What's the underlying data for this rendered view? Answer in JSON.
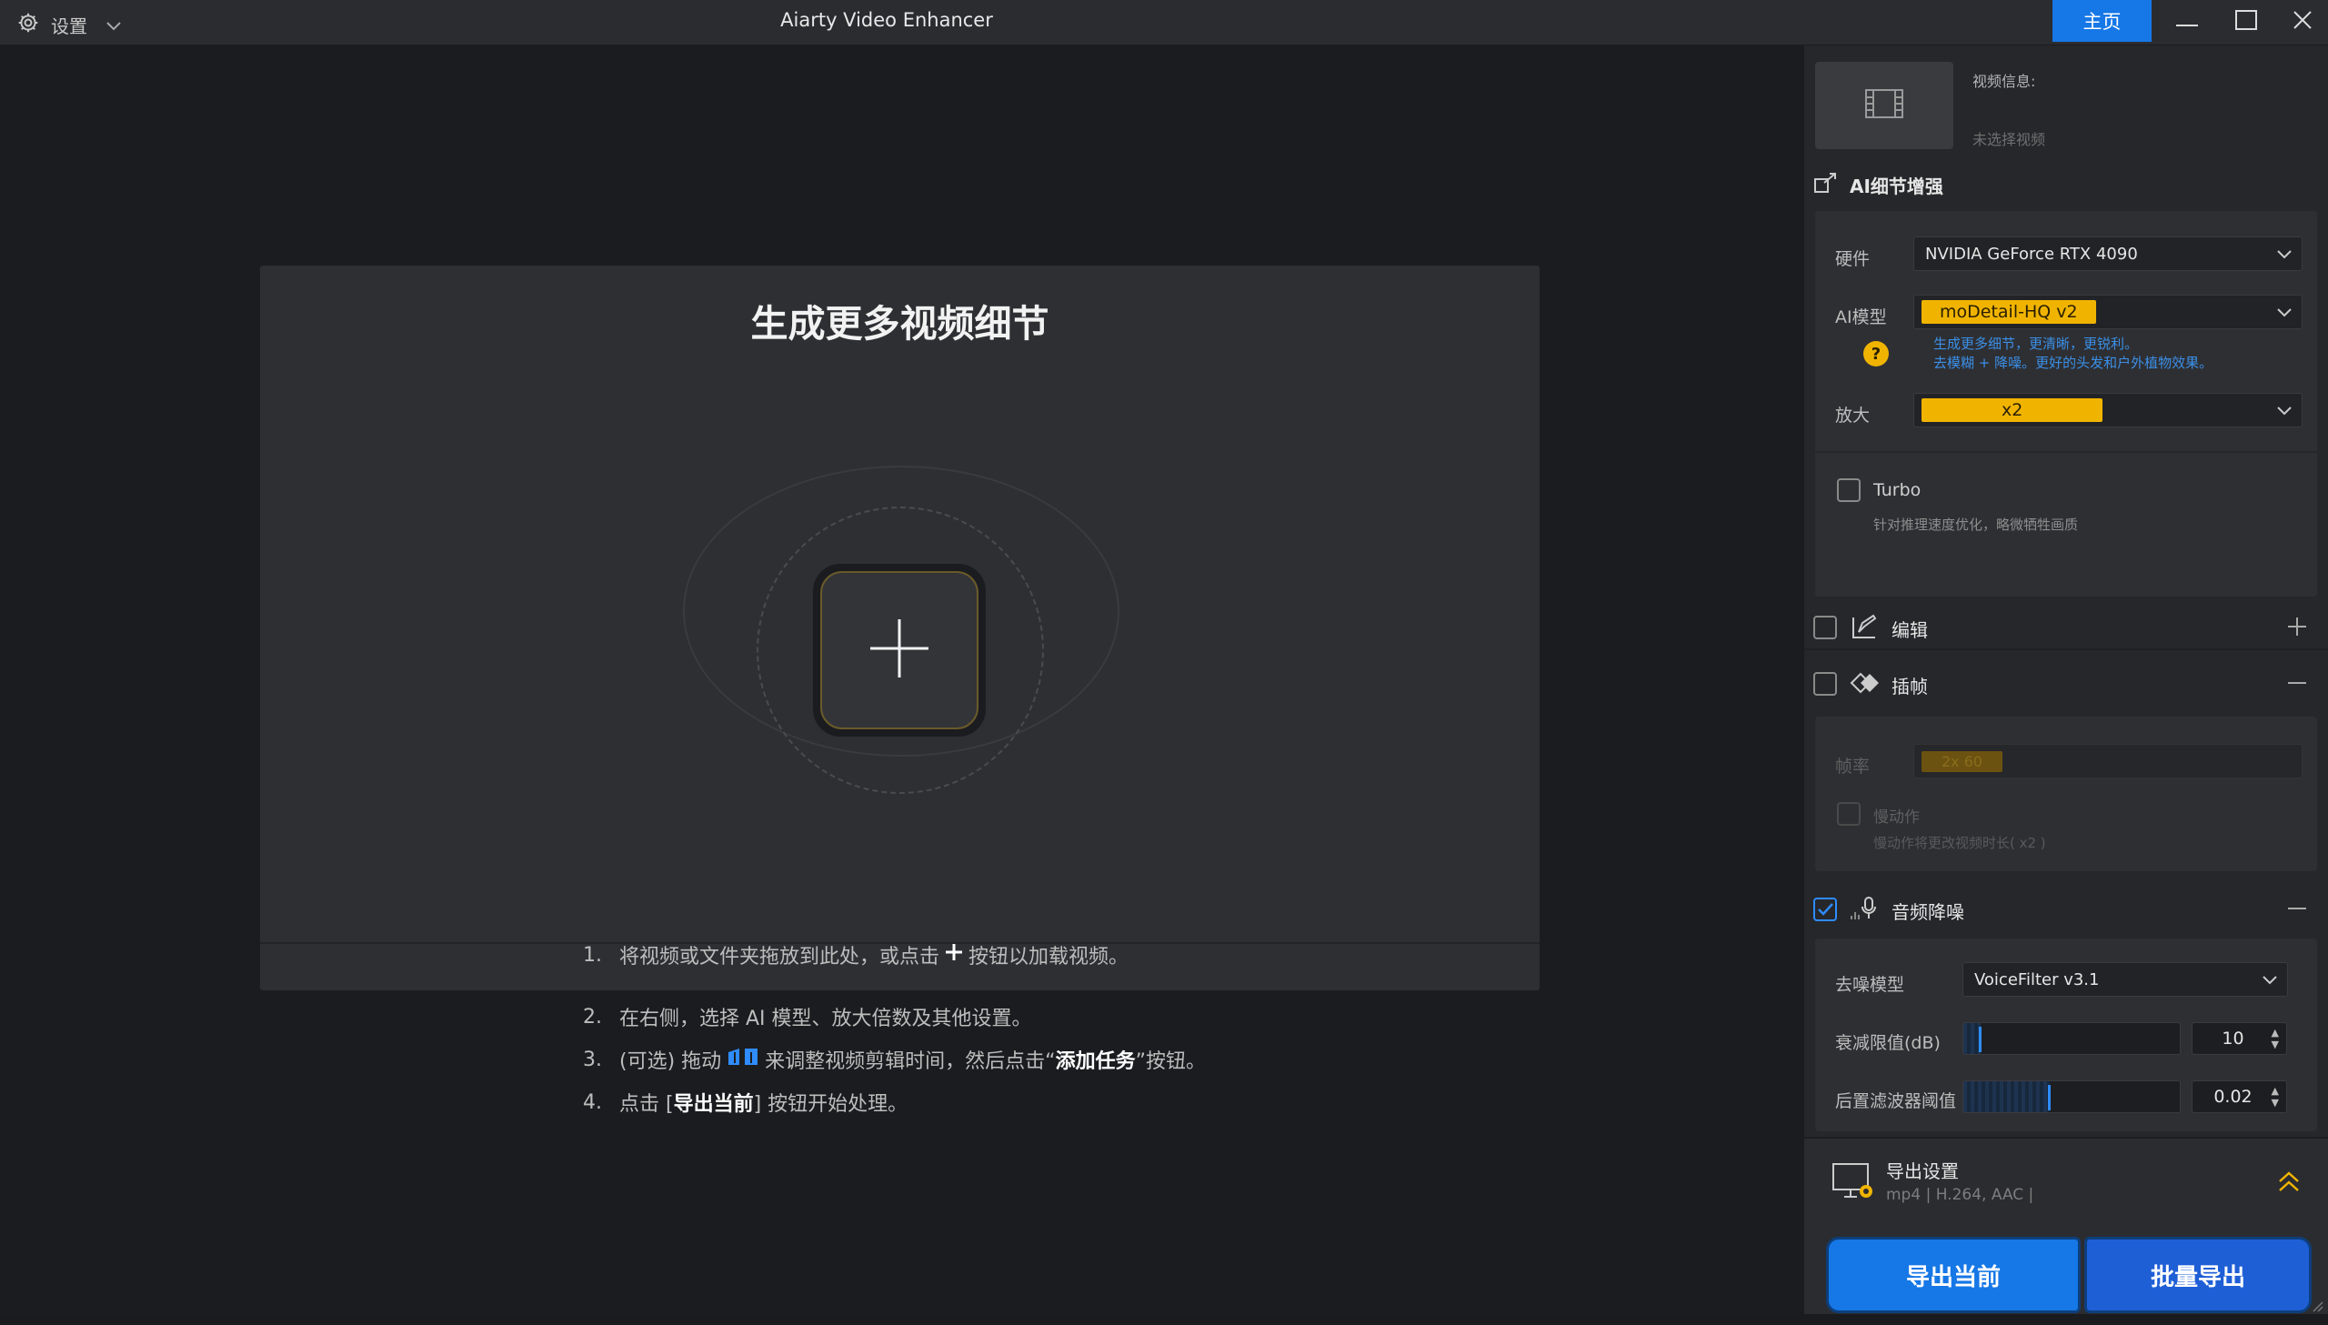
{
  "titlebar": {
    "settings_label": "设置",
    "app_title": "Aiarty Video Enhancer",
    "home_label": "主页"
  },
  "main": {
    "drop_title": "生成更多视频细节",
    "steps": [
      {
        "num": "1.",
        "pre": "将视频或文件夹拖放到此处，或点击",
        "post": "按钮以加载视频。"
      },
      {
        "num": "2.",
        "text": "在右侧，选择 AI 模型、放大倍数及其他设置。"
      },
      {
        "num": "3.",
        "pre": "(可选) 拖动",
        "mid": "来调整视频剪辑时间，然后点击“",
        "bold": "添加任务",
        "post": "”按钮。"
      },
      {
        "num": "4.",
        "pre": "点击 [ ",
        "bold": "导出当前",
        "post": " ] 按钮开始处理。"
      }
    ]
  },
  "panel": {
    "video_info_label": "视频信息:",
    "video_info_value": "未选择视频",
    "ai_detail": {
      "title": "AI细节增强",
      "hardware_label": "硬件",
      "hardware_value": "NVIDIA GeForce RTX 4090",
      "model_label": "AI模型",
      "model_value": "moDetail-HQ  v2",
      "model_desc_1": "生成更多细节，更清晰，更锐利。",
      "model_desc_2": "去模糊 + 降噪。更好的头发和户外植物效果。",
      "scale_label": "放大",
      "scale_value": "x2",
      "turbo_label": "Turbo",
      "turbo_hint": "针对推理速度优化，略微牺牲画质"
    },
    "edit": {
      "title": "编辑"
    },
    "interp": {
      "title": "插帧",
      "fps_label": "帧率",
      "fps_value": "2x 60",
      "slowmo_label": "慢动作",
      "slowmo_hint": "慢动作将更改视频时长( x2 )"
    },
    "audio": {
      "title": "音频降噪",
      "model_label": "去噪模型",
      "model_value": "VoiceFilter v3.1",
      "atten_label": "衰减限值(dB)",
      "atten_value": "10",
      "atten_level": 0.08,
      "post_label": "后置滤波器阈值",
      "post_value": "0.02",
      "post_level": 0.4
    },
    "export": {
      "title": "导出设置",
      "format": "mp4 | H.264, AAC |",
      "export_now": "导出当前",
      "batch_export": "批量导出"
    }
  },
  "colors": {
    "accent_blue": "#1677e6",
    "accent_yellow": "#f0b400"
  }
}
